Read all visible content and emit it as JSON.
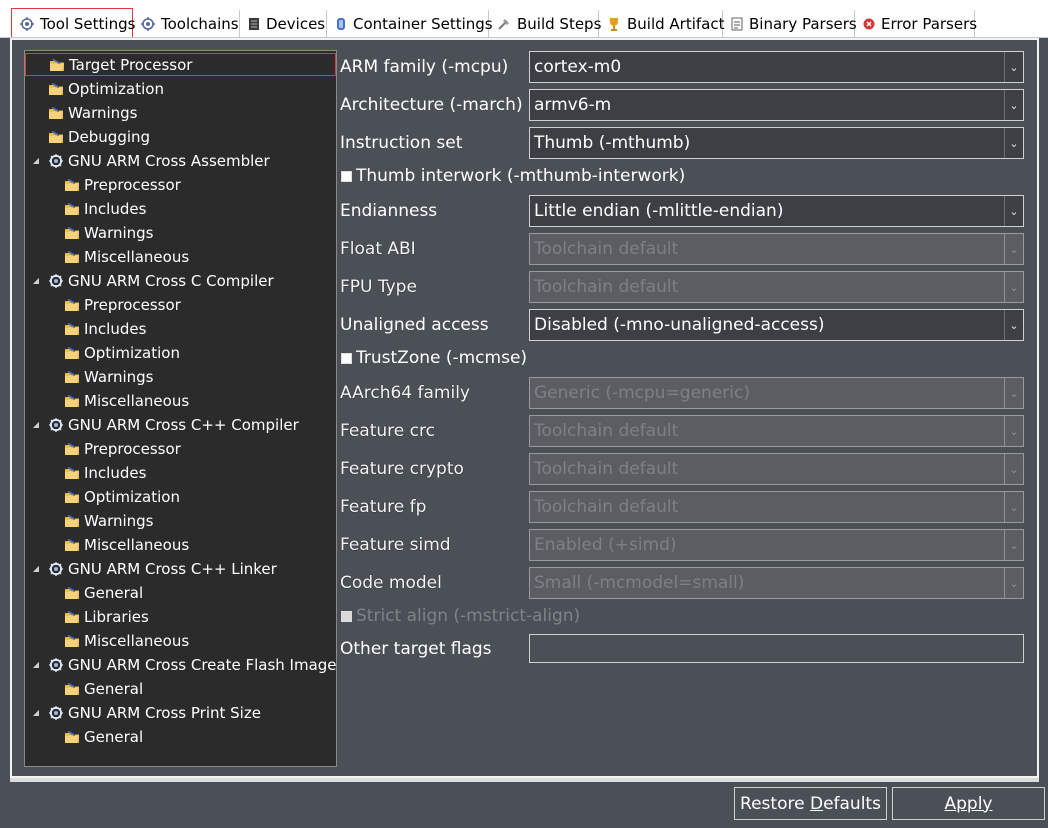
{
  "tabs": [
    {
      "label": "Tool Settings",
      "icon": "tool-settings-icon",
      "active": true
    },
    {
      "label": "Toolchains",
      "icon": "toolchains-icon"
    },
    {
      "label": "Devices",
      "icon": "devices-icon"
    },
    {
      "label": "Container Settings",
      "icon": "container-icon"
    },
    {
      "label": "Build Steps",
      "icon": "build-steps-icon"
    },
    {
      "label": "Build Artifact",
      "icon": "build-artifact-icon"
    },
    {
      "label": "Binary Parsers",
      "icon": "binary-parsers-icon"
    },
    {
      "label": "Error Parsers",
      "icon": "error-parsers-icon"
    }
  ],
  "tree": {
    "items": [
      {
        "label": "Target Processor",
        "level": 0,
        "type": "option",
        "selected": true
      },
      {
        "label": "Optimization",
        "level": 0,
        "type": "option"
      },
      {
        "label": "Warnings",
        "level": 0,
        "type": "option"
      },
      {
        "label": "Debugging",
        "level": 0,
        "type": "option"
      },
      {
        "label": "GNU ARM Cross Assembler",
        "level": 0,
        "type": "tool",
        "expanded": true
      },
      {
        "label": "Preprocessor",
        "level": 1,
        "type": "option"
      },
      {
        "label": "Includes",
        "level": 1,
        "type": "option"
      },
      {
        "label": "Warnings",
        "level": 1,
        "type": "option"
      },
      {
        "label": "Miscellaneous",
        "level": 1,
        "type": "option"
      },
      {
        "label": "GNU ARM Cross C Compiler",
        "level": 0,
        "type": "tool",
        "expanded": true
      },
      {
        "label": "Preprocessor",
        "level": 1,
        "type": "option"
      },
      {
        "label": "Includes",
        "level": 1,
        "type": "option"
      },
      {
        "label": "Optimization",
        "level": 1,
        "type": "option"
      },
      {
        "label": "Warnings",
        "level": 1,
        "type": "option"
      },
      {
        "label": "Miscellaneous",
        "level": 1,
        "type": "option"
      },
      {
        "label": "GNU ARM Cross C++ Compiler",
        "level": 0,
        "type": "tool",
        "expanded": true
      },
      {
        "label": "Preprocessor",
        "level": 1,
        "type": "option"
      },
      {
        "label": "Includes",
        "level": 1,
        "type": "option"
      },
      {
        "label": "Optimization",
        "level": 1,
        "type": "option"
      },
      {
        "label": "Warnings",
        "level": 1,
        "type": "option"
      },
      {
        "label": "Miscellaneous",
        "level": 1,
        "type": "option"
      },
      {
        "label": "GNU ARM Cross C++ Linker",
        "level": 0,
        "type": "tool",
        "expanded": true
      },
      {
        "label": "General",
        "level": 1,
        "type": "option"
      },
      {
        "label": "Libraries",
        "level": 1,
        "type": "option"
      },
      {
        "label": "Miscellaneous",
        "level": 1,
        "type": "option"
      },
      {
        "label": "GNU ARM Cross Create Flash Image",
        "level": 0,
        "type": "tool",
        "expanded": true
      },
      {
        "label": "General",
        "level": 1,
        "type": "option"
      },
      {
        "label": "GNU ARM Cross Print Size",
        "level": 0,
        "type": "tool",
        "expanded": true
      },
      {
        "label": "General",
        "level": 1,
        "type": "option"
      }
    ]
  },
  "form": {
    "arm_family": {
      "label": "ARM family (-mcpu)",
      "value": "cortex-m0",
      "enabled": true
    },
    "architecture": {
      "label": "Architecture (-march)",
      "value": "armv6-m",
      "enabled": true
    },
    "instruction_set": {
      "label": "Instruction set",
      "value": "Thumb (-mthumb)",
      "enabled": true
    },
    "thumb_interwork": {
      "label": "Thumb interwork (-mthumb-interwork)",
      "checked": false,
      "enabled": true
    },
    "endianness": {
      "label": "Endianness",
      "value": "Little endian (-mlittle-endian)",
      "enabled": true
    },
    "float_abi": {
      "label": "Float ABI",
      "value": "Toolchain default",
      "enabled": false
    },
    "fpu_type": {
      "label": "FPU Type",
      "value": "Toolchain default",
      "enabled": false
    },
    "unaligned_access": {
      "label": "Unaligned access",
      "value": "Disabled (-mno-unaligned-access)",
      "enabled": true
    },
    "trustzone": {
      "label": "TrustZone (-mcmse)",
      "checked": false,
      "enabled": true
    },
    "aarch64_family": {
      "label": "AArch64 family",
      "value": "Generic (-mcpu=generic)",
      "enabled": false
    },
    "feature_crc": {
      "label": "Feature crc",
      "value": "Toolchain default",
      "enabled": false
    },
    "feature_crypto": {
      "label": "Feature crypto",
      "value": "Toolchain default",
      "enabled": false
    },
    "feature_fp": {
      "label": "Feature fp",
      "value": "Toolchain default",
      "enabled": false
    },
    "feature_simd": {
      "label": "Feature simd",
      "value": "Enabled (+simd)",
      "enabled": false
    },
    "code_model": {
      "label": "Code model",
      "value": "Small (-mcmodel=small)",
      "enabled": false
    },
    "strict_align": {
      "label": "Strict align (-mstrict-align)",
      "checked": false,
      "enabled": false
    },
    "other_flags": {
      "label": "Other target flags",
      "value": ""
    }
  },
  "buttons": {
    "restore_prefix": "Restore ",
    "restore_mnemonic": "D",
    "restore_suffix": "efaults",
    "apply_mnemonic": "A",
    "apply_suffix": "pply"
  },
  "colors": {
    "background": "#4b5056",
    "tree_background": "#2b2b2b",
    "selection_border": "#d93b3b",
    "text": "#ffffff",
    "disabled_text": "#7d8186"
  }
}
